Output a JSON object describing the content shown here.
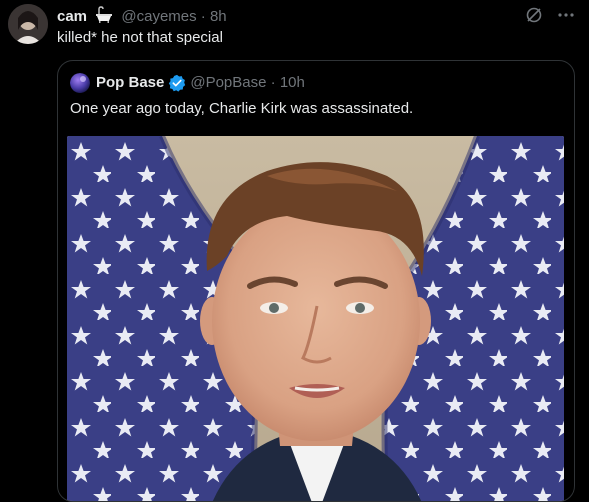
{
  "tweet": {
    "display_name": "cam",
    "handle": "@cayemes",
    "time": "8h",
    "text": "killed* he not that special"
  },
  "quoted": {
    "display_name": "Pop Base",
    "handle": "@PopBase",
    "time": "10h",
    "text": "One year ago today, Charlie Kirk was assassinated."
  },
  "colors": {
    "background": "#000000",
    "muted": "#71767b",
    "verified": "#1d9bf0"
  },
  "icons": [
    "bathtub-emoji-icon",
    "verified-badge-icon",
    "grok-icon",
    "more-icon"
  ]
}
